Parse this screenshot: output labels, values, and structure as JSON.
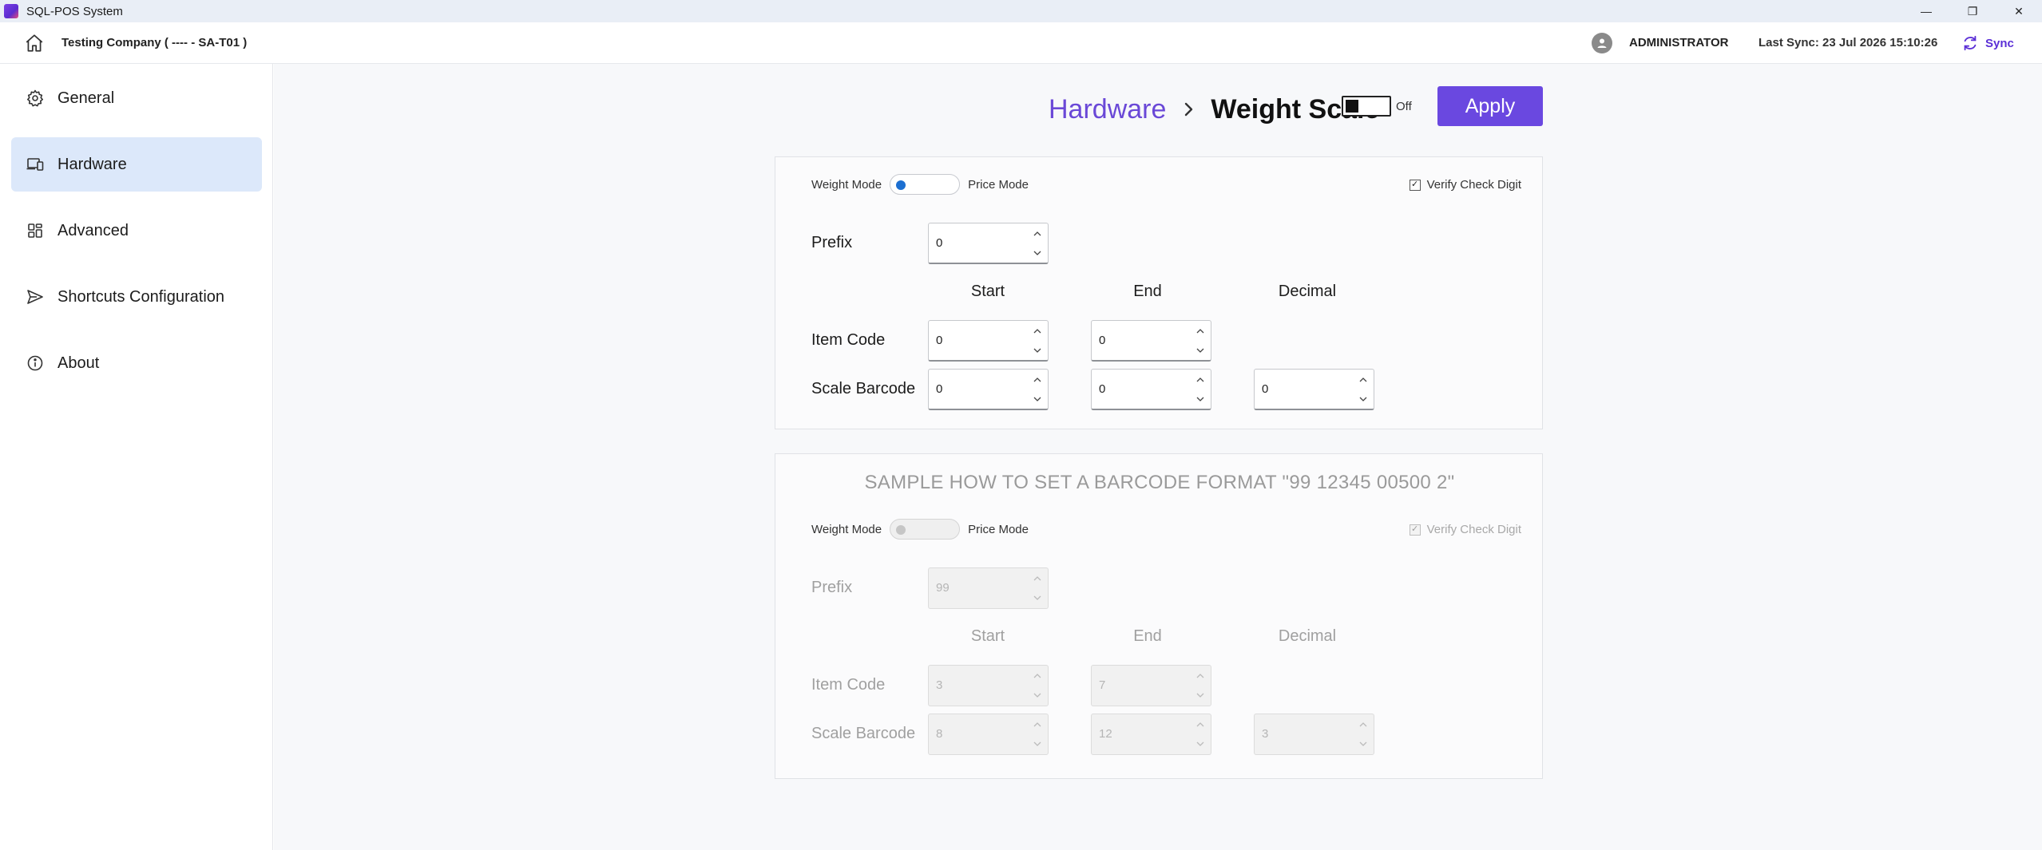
{
  "window": {
    "title": "SQL-POS System",
    "controls": {
      "minimize": "—",
      "restore": "❐",
      "close": "✕"
    }
  },
  "header": {
    "company": "Testing Company ( ---- - SA-T01 )",
    "user": "ADMINISTRATOR",
    "last_sync": "Last Sync: 23 Jul 2026 15:10:26",
    "sync_label": "Sync",
    "accent": "#5b2fd6"
  },
  "sidebar": {
    "items": [
      {
        "label": "General",
        "icon": "gear-icon"
      },
      {
        "label": "Hardware",
        "icon": "devices-icon",
        "active": true
      },
      {
        "label": "Advanced",
        "icon": "grid-icon"
      },
      {
        "label": "Shortcuts Configuration",
        "icon": "send-icon"
      },
      {
        "label": "About",
        "icon": "info-icon"
      }
    ]
  },
  "breadcrumb": {
    "parent": "Hardware",
    "current": "Weight Scale"
  },
  "toggle": {
    "state_label": "Off"
  },
  "apply_label": "Apply",
  "config": {
    "weight_mode_label": "Weight Mode",
    "price_mode_label": "Price Mode",
    "verify_label": "Verify Check Digit",
    "verify_checked": true,
    "prefix_label": "Prefix",
    "columns": {
      "start": "Start",
      "end": "End",
      "decimal": "Decimal"
    },
    "item_code_label": "Item Code",
    "scale_barcode_label": "Scale Barcode",
    "prefix_value": "0",
    "item_code": {
      "start": "0",
      "end": "0"
    },
    "scale_barcode": {
      "start": "0",
      "end": "0",
      "decimal": "0"
    }
  },
  "sample": {
    "title": "SAMPLE HOW TO SET A BARCODE FORMAT \"99 12345 00500 2\"",
    "weight_mode_label": "Weight Mode",
    "price_mode_label": "Price Mode",
    "verify_label": "Verify Check Digit",
    "verify_checked": true,
    "prefix_label": "Prefix",
    "columns": {
      "start": "Start",
      "end": "End",
      "decimal": "Decimal"
    },
    "item_code_label": "Item Code",
    "scale_barcode_label": "Scale Barcode",
    "prefix_value": "99",
    "item_code": {
      "start": "3",
      "end": "7"
    },
    "scale_barcode": {
      "start": "8",
      "end": "12",
      "decimal": "3"
    }
  },
  "colors": {
    "accent": "#6a48e0",
    "active_nav": "#dce8fa",
    "switch_dot": "#1c6fd1"
  }
}
